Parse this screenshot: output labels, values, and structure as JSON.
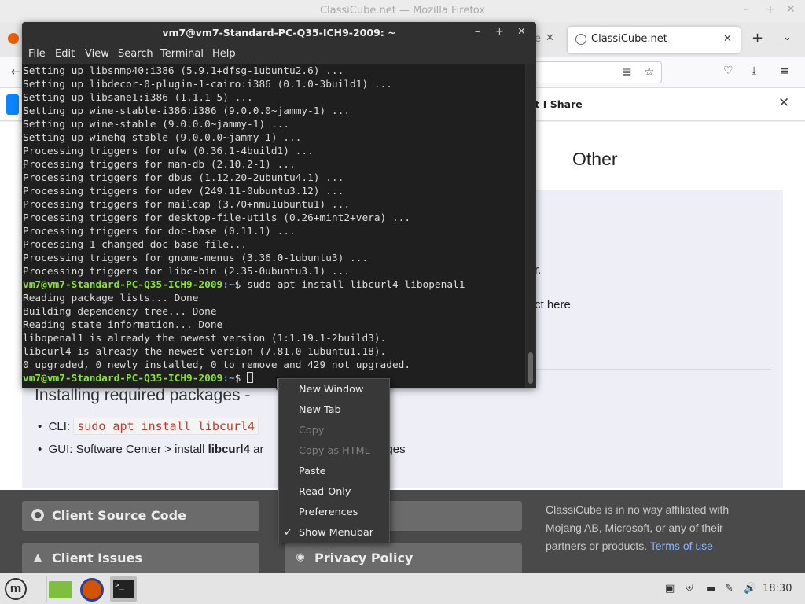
{
  "firefox": {
    "window_title": "ClassiCube.net — Mozilla Firefox",
    "active_tab": "ClassiCube.net",
    "partial_tab_text": "e",
    "notification_text": "at I Share",
    "page": {
      "heading_other": "Other",
      "fragment_1": "r.",
      "fragment_2": "ct here",
      "installing_heading": "Installing required packages - ",
      "cli_label": "CLI: ",
      "cli_code": "sudo apt install libcurl4 ",
      "gui_text_1": "GUI: Software Center > install ",
      "gui_bold": "libcurl4",
      "gui_text_2": " ar",
      "gui_text_3": "ges",
      "footer_btn_source": "Client Source Code",
      "footer_btn_issues": "Client Issues",
      "footer_btn_privacy": "Privacy Policy",
      "footer_note": "ClassiCube is in no way affiliated with Mojang AB, Microsoft, or any of their partners or products.",
      "footer_terms": "Terms of use"
    }
  },
  "terminal": {
    "title": "vm7@vm7-Standard-PC-Q35-ICH9-2009: ~",
    "menu": [
      "File",
      "Edit",
      "View",
      "Search",
      "Terminal",
      "Help"
    ],
    "lines": [
      "Setting up libsnmp40:i386 (5.9.1+dfsg-1ubuntu2.6) ...",
      "Setting up libdecor-0-plugin-1-cairo:i386 (0.1.0-3build1) ...",
      "Setting up libsane1:i386 (1.1.1-5) ...",
      "Setting up wine-stable-i386:i386 (9.0.0.0~jammy-1) ...",
      "Setting up wine-stable (9.0.0.0~jammy-1) ...",
      "Setting up winehq-stable (9.0.0.0~jammy-1) ...",
      "Processing triggers for ufw (0.36.1-4build1) ...",
      "Processing triggers for man-db (2.10.2-1) ...",
      "Processing triggers for dbus (1.12.20-2ubuntu4.1) ...",
      "Processing triggers for udev (249.11-0ubuntu3.12) ...",
      "Processing triggers for mailcap (3.70+nmu1ubuntu1) ...",
      "Processing triggers for desktop-file-utils (0.26+mint2+vera) ...",
      "Processing triggers for doc-base (0.11.1) ...",
      "Processing 1 changed doc-base file...",
      "Processing triggers for gnome-menus (3.36.0-1ubuntu3) ...",
      "Processing triggers for libc-bin (2.35-0ubuntu3.1) ..."
    ],
    "prompt_user": "vm7@vm7-Standard-PC-Q35-ICH9-2009",
    "prompt_path": ":~",
    "prompt_symbol": "$ ",
    "command": "sudo apt install libcurl4 libopenal1",
    "output": [
      "Reading package lists... Done",
      "Building dependency tree... Done",
      "Reading state information... Done",
      "libopenal1 is already the newest version (1:1.19.1-2build3).",
      "libcurl4 is already the newest version (7.81.0-1ubuntu1.18).",
      "0 upgraded, 0 newly installed, 0 to remove and 429 not upgraded."
    ]
  },
  "context_menu": {
    "items": [
      {
        "label": "New Window",
        "enabled": true
      },
      {
        "label": "New Tab",
        "enabled": true
      },
      {
        "label": "Copy",
        "enabled": false
      },
      {
        "label": "Copy as HTML",
        "enabled": false
      },
      {
        "label": "Paste",
        "enabled": true
      },
      {
        "label": "Read-Only",
        "enabled": true
      },
      {
        "label": "Preferences",
        "enabled": true
      },
      {
        "label": "Show Menubar",
        "enabled": true,
        "checked": true
      }
    ]
  },
  "taskbar": {
    "clock": "18:30"
  },
  "colors": {
    "prompt_user": "#8ae234",
    "prompt_path": "#729fcf",
    "terminal_bg": "#1f1f1f",
    "footer_bg": "#4a4a4a",
    "terms_link": "#8ab4f8"
  }
}
